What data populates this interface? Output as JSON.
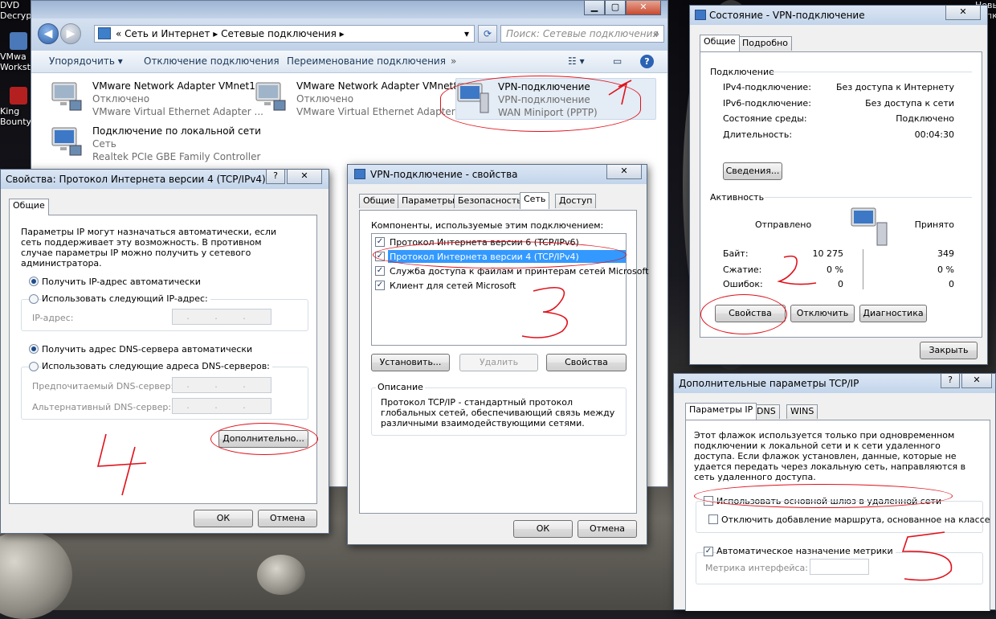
{
  "desktop": {
    "left_icons": [
      {
        "label": "DVD Decryp"
      },
      {
        "label": "VMwa Workst"
      },
      {
        "label": "King Bounty"
      }
    ],
    "right_icons": [
      {
        "label": "Новы папк"
      }
    ]
  },
  "explorer": {
    "breadcrumb": [
      "Сеть и Интернет",
      "Сетевые подключения"
    ],
    "search_placeholder": "Поиск: Сетевые подключения",
    "commands": [
      "Упорядочить",
      "Отключение подключения",
      "Переименование подключения"
    ],
    "adapters": [
      {
        "name": "VMware Network Adapter VMnet1",
        "status": "Отключено",
        "device": "VMware Virtual Ethernet Adapter ..."
      },
      {
        "name": "VMware Network Adapter VMnet8",
        "status": "Отключено",
        "device": "VMware Virtual Ethernet Adapter ..."
      },
      {
        "name": "VPN-подключение",
        "status": "VPN-подключение",
        "device": "WAN Miniport (PPTP)"
      },
      {
        "name": "Подключение по локальной сети",
        "status": "Сеть",
        "device": "Realtek PCIe GBE Family Controller"
      }
    ]
  },
  "ipv4": {
    "title": "Свойства: Протокол Интернета версии 4 (TCP/IPv4)",
    "tab": "Общие",
    "intro": "Параметры IP могут назначаться автоматически, если сеть поддерживает эту возможность. В противном случае параметры IP можно получить у сетевого администратора.",
    "radio_ip_auto": "Получить IP-адрес автоматически",
    "radio_ip_manual": "Использовать следующий IP-адрес:",
    "ip_label": "IP-адрес:",
    "radio_dns_auto": "Получить адрес DNS-сервера автоматически",
    "radio_dns_manual": "Использовать следующие адреса DNS-серверов:",
    "dns_pref": "Предпочитаемый DNS-сервер:",
    "dns_alt": "Альтернативный DNS-сервер:",
    "ip_placeholder": ". . .",
    "advanced": "Дополнительно...",
    "ok": "ОК",
    "cancel": "Отмена"
  },
  "vpnprops": {
    "title": "VPN-подключение - свойства",
    "tabs": [
      "Общие",
      "Параметры",
      "Безопасность",
      "Сеть",
      "Доступ"
    ],
    "components_label": "Компоненты, используемые этим подключением:",
    "components": [
      {
        "label": "Протокол Интернета версии 6 (TCP/IPv6)",
        "checked": true
      },
      {
        "label": "Протокол Интернета версии 4 (TCP/IPv4)",
        "checked": true
      },
      {
        "label": "Служба доступа к файлам и принтерам сетей Microsoft",
        "checked": true
      },
      {
        "label": "Клиент для сетей Microsoft",
        "checked": true
      }
    ],
    "install": "Установить...",
    "remove": "Удалить",
    "properties": "Свойства",
    "desc_label": "Описание",
    "desc": "Протокол TCP/IP - стандартный протокол глобальных сетей, обеспечивающий связь между различными взаимодействующими сетями.",
    "ok": "ОК",
    "cancel": "Отмена"
  },
  "status": {
    "title": "Состояние - VPN-подключение",
    "tabs": [
      "Общие",
      "Подробно"
    ],
    "conn_label": "Подключение",
    "rows": [
      {
        "k": "IPv4-подключение:",
        "v": "Без доступа к Интернету"
      },
      {
        "k": "IPv6-подключение:",
        "v": "Без доступа к сети"
      },
      {
        "k": "Состояние среды:",
        "v": "Подключено"
      },
      {
        "k": "Длительность:",
        "v": "00:04:30"
      }
    ],
    "details": "Сведения...",
    "activity": "Активность",
    "sent": "Отправлено",
    "received": "Принято",
    "stats": [
      {
        "k": "Байт:",
        "s": "10 275",
        "r": "349"
      },
      {
        "k": "Сжатие:",
        "s": "0 %",
        "r": "0 %"
      },
      {
        "k": "Ошибок:",
        "s": "0",
        "r": "0"
      }
    ],
    "btn_props": "Свойства",
    "btn_disconnect": "Отключить",
    "btn_diag": "Диагностика",
    "close": "Закрыть"
  },
  "advanced": {
    "title": "Дополнительные параметры TCP/IP",
    "tabs": [
      "Параметры IP",
      "DNS",
      "WINS"
    ],
    "info": "Этот флажок используется только при одновременном подключении к локальной сети и к сети удаленного доступа. Если флажок установлен, данные, которые не удается передать через локальную сеть, направляются в сеть удаленного доступа.",
    "chk_gateway": "Использовать основной шлюз в удаленной сети",
    "chk_route": "Отключить добавление маршрута, основанное на классе",
    "chk_metric": "Автоматическое назначение метрики",
    "metric_label": "Метрика интерфейса:"
  },
  "colors": {
    "accent": "#3399ff",
    "annotation": "#e0111b",
    "title_bar": "#c2d4ea"
  }
}
